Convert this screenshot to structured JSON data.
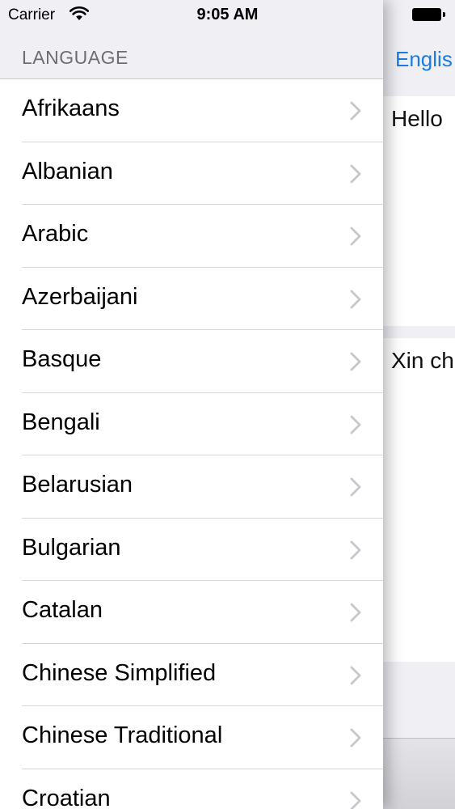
{
  "status_bar": {
    "carrier": "Carrier",
    "time": "9:05 AM"
  },
  "drawer": {
    "section_header": "LANGUAGE",
    "languages": [
      "Afrikaans",
      "Albanian",
      "Arabic",
      "Azerbaijani",
      "Basque",
      "Bengali",
      "Belarusian",
      "Bulgarian",
      "Catalan",
      "Chinese Simplified",
      "Chinese Traditional",
      "Croatian"
    ]
  },
  "translator": {
    "source_language": "Englis",
    "source_text": "Hello",
    "target_text": "Xin ch"
  },
  "colors": {
    "accent": "#1a7ce0",
    "background": "#efeff4",
    "separator": "#d6d6da",
    "chevron": "#c7c7cc"
  }
}
